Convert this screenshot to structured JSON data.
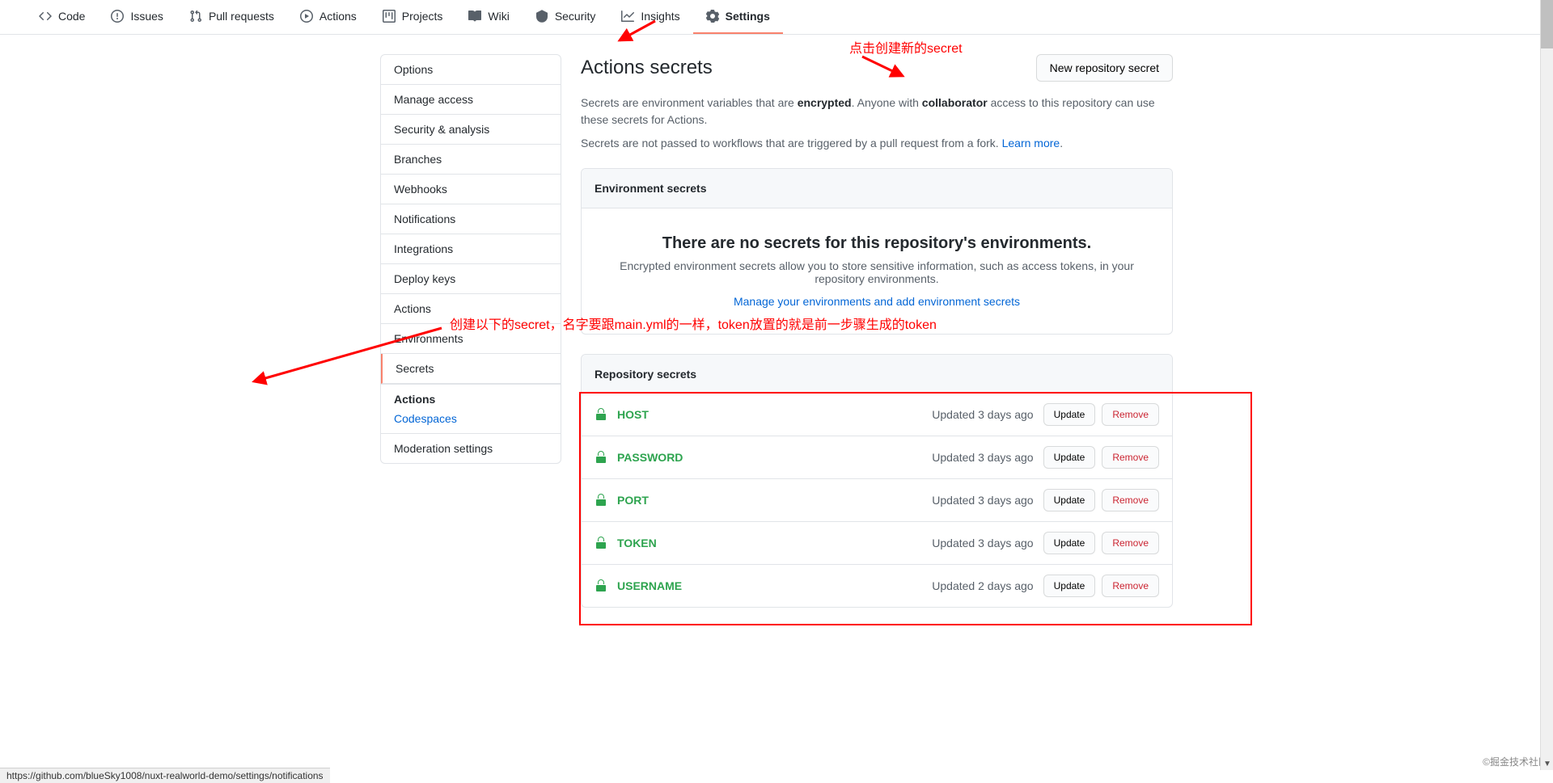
{
  "tabs": {
    "code": "Code",
    "issues": "Issues",
    "pulls": "Pull requests",
    "actions": "Actions",
    "projects": "Projects",
    "wiki": "Wiki",
    "security": "Security",
    "insights": "Insights",
    "settings": "Settings"
  },
  "sidebar": {
    "items": {
      "options": "Options",
      "manage_access": "Manage access",
      "security_analysis": "Security & analysis",
      "branches": "Branches",
      "webhooks": "Webhooks",
      "notifications": "Notifications",
      "integrations": "Integrations",
      "deploy_keys": "Deploy keys",
      "actions": "Actions",
      "environments": "Environments",
      "secrets": "Secrets"
    },
    "section2_heading": "Actions",
    "section2_link": "Codespaces",
    "moderation": "Moderation settings"
  },
  "content": {
    "title": "Actions secrets",
    "new_btn": "New repository secret",
    "desc_pre": "Secrets are environment variables that are ",
    "desc_enc": "encrypted",
    "desc_mid1": ". Anyone with ",
    "desc_collab": "collaborator",
    "desc_mid2": " access to this repository can use these secrets for Actions.",
    "desc2_pre": "Secrets are not passed to workflows that are triggered by a pull request from a fork. ",
    "desc2_link": "Learn more",
    "desc2_post": ".",
    "env_header": "Environment secrets",
    "env_empty_title": "There are no secrets for this repository's environments.",
    "env_empty_sub": "Encrypted environment secrets allow you to store sensitive information, such as access tokens, in your repository environments.",
    "env_empty_link": "Manage your environments and add environment secrets",
    "repo_header": "Repository secrets",
    "update_btn": "Update",
    "remove_btn": "Remove",
    "secrets": [
      {
        "name": "HOST",
        "updated": "Updated 3 days ago"
      },
      {
        "name": "PASSWORD",
        "updated": "Updated 3 days ago"
      },
      {
        "name": "PORT",
        "updated": "Updated 3 days ago"
      },
      {
        "name": "TOKEN",
        "updated": "Updated 3 days ago"
      },
      {
        "name": "USERNAME",
        "updated": "Updated 2 days ago"
      }
    ]
  },
  "annotations": {
    "a1": "点击创建新的secret",
    "a2": "创建以下的secret，名字要跟main.yml的一样，token放置的就是前一步骤生成的token"
  },
  "status_bar": "https://github.com/blueSky1008/nuxt-realworld-demo/settings/notifications",
  "watermark": "©掘金技术社区"
}
